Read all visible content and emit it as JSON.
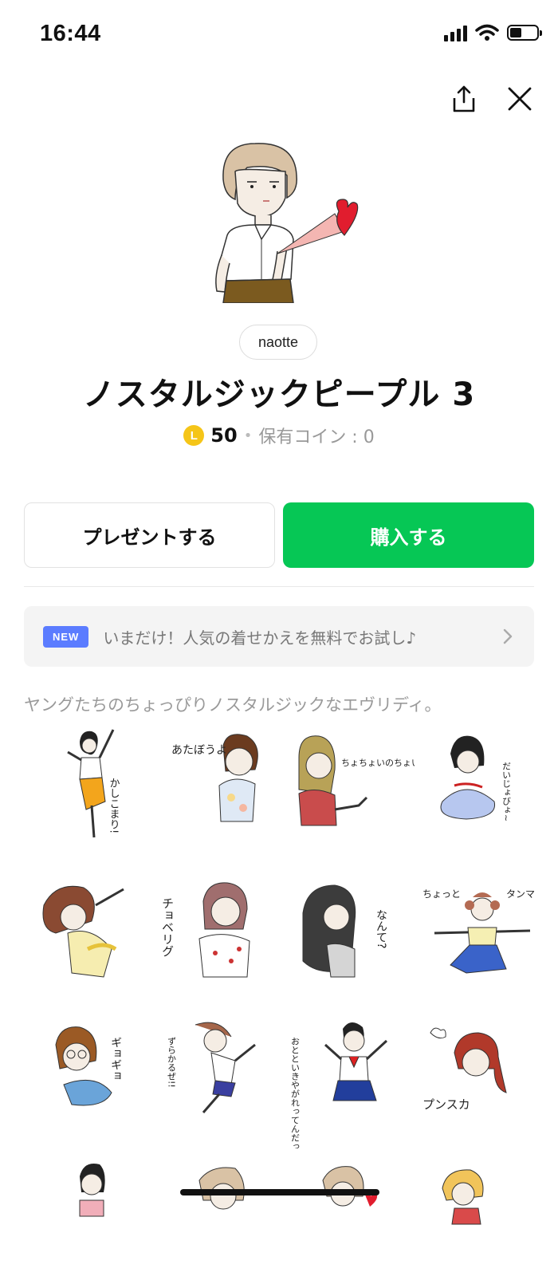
{
  "status_bar": {
    "time": "16:44",
    "battery_level": 0.45
  },
  "header": {
    "share_icon": "share-icon",
    "close_icon": "close-icon"
  },
  "product": {
    "author": "naotte",
    "title": "ノスタルジックピープル 3",
    "coin_symbol": "L",
    "price": "50",
    "separator": "•",
    "owned_coins": "保有コイン : 0"
  },
  "actions": {
    "gift_label": "プレゼントする",
    "buy_label": "購入する"
  },
  "promo": {
    "badge": "NEW",
    "text": "いまだけ！人気の着せかえを無料でお試し♪"
  },
  "description": "ヤングたちのちょっぴりノスタルジックなエヴリディ。",
  "stickers": {
    "s1": {
      "caption": "かしこまり!"
    },
    "s2": {
      "caption": "あたぼうよ"
    },
    "s3": {
      "caption": "ちょちょいのちょいよ!"
    },
    "s4": {
      "caption": "だいじょびょ~"
    },
    "s6": {
      "caption": "チョベリグ"
    },
    "s7": {
      "caption": "なんて?"
    },
    "s8": {
      "caption_a": "ちょっと",
      "caption_b": "タンマ"
    },
    "s9": {
      "caption": "ギョギョ"
    },
    "s10": {
      "caption": "ずらかるぜ!!"
    },
    "s11": {
      "caption": "おとといきやがれってんだっ"
    },
    "s12": {
      "caption": "プンスカ"
    }
  },
  "colors": {
    "accent_green": "#06c755",
    "new_badge": "#5b7cff",
    "coin": "#f5c518"
  }
}
